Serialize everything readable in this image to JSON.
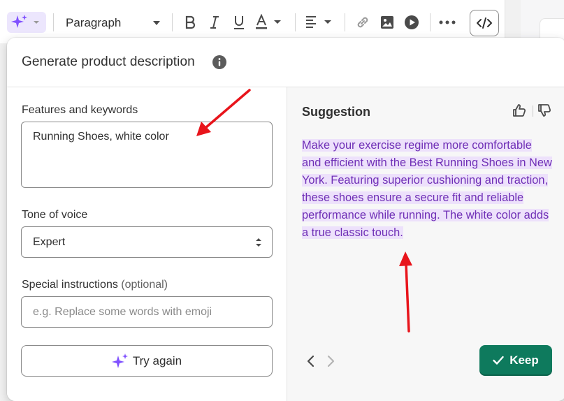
{
  "toolbar": {
    "paragraph_label": "Paragraph",
    "icons": [
      "sparkle-icon",
      "chevron-down-icon",
      "bold-icon",
      "italic-icon",
      "underline-icon",
      "text-color-icon",
      "align-left-icon",
      "link-icon",
      "image-icon",
      "video-icon",
      "more-icon",
      "code-icon"
    ]
  },
  "dialog": {
    "title": "Generate product description",
    "features": {
      "label": "Features and keywords",
      "value": "Running Shoes, white color"
    },
    "tone": {
      "label": "Tone of voice",
      "value": "Expert"
    },
    "special": {
      "label": "Special instructions",
      "optional": "(optional)",
      "placeholder": "e.g. Replace some words with emoji"
    },
    "try_again_label": "Try again",
    "suggestion": {
      "title": "Suggestion",
      "text": "Make your exercise regime more comfortable and efficient with the Best Running Shoes in New York. Featuring superior cushioning and traction, these shoes ensure a secure fit and reliable performance while running. The white color adds a true classic touch."
    },
    "keep_label": "Keep"
  },
  "colors": {
    "accent_purple": "#8051ff",
    "suggestion_text": "#6f2fb6",
    "suggestion_highlight": "#ede1fb",
    "keep_green": "#0e7a5d",
    "annotation_arrow": "#e8141b"
  }
}
